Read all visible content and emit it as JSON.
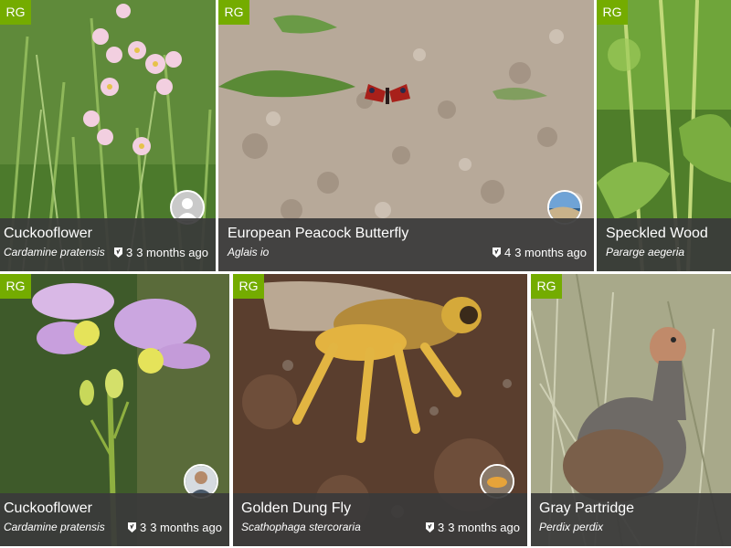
{
  "badge_label": "RG",
  "cards": [
    {
      "common": "Cuckooflower",
      "scientific": "Cardamine pratensis",
      "ids": "3",
      "time": "3 months ago"
    },
    {
      "common": "European Peacock Butterfly",
      "scientific": "Aglais io",
      "ids": "4",
      "time": "3 months ago"
    },
    {
      "common": "Speckled Wood",
      "scientific": "Pararge aegeria",
      "ids": "",
      "time": ""
    },
    {
      "common": "Cuckooflower",
      "scientific": "Cardamine pratensis",
      "ids": "3",
      "time": "3 months ago"
    },
    {
      "common": "Golden Dung Fly",
      "scientific": "Scathophaga stercoraria",
      "ids": "3",
      "time": "3 months ago"
    },
    {
      "common": "Gray Partridge",
      "scientific": "Perdix perdix",
      "ids": "",
      "time": ""
    }
  ],
  "colors": {
    "badge": "#74ac00",
    "caption": "#3a3a3a"
  }
}
